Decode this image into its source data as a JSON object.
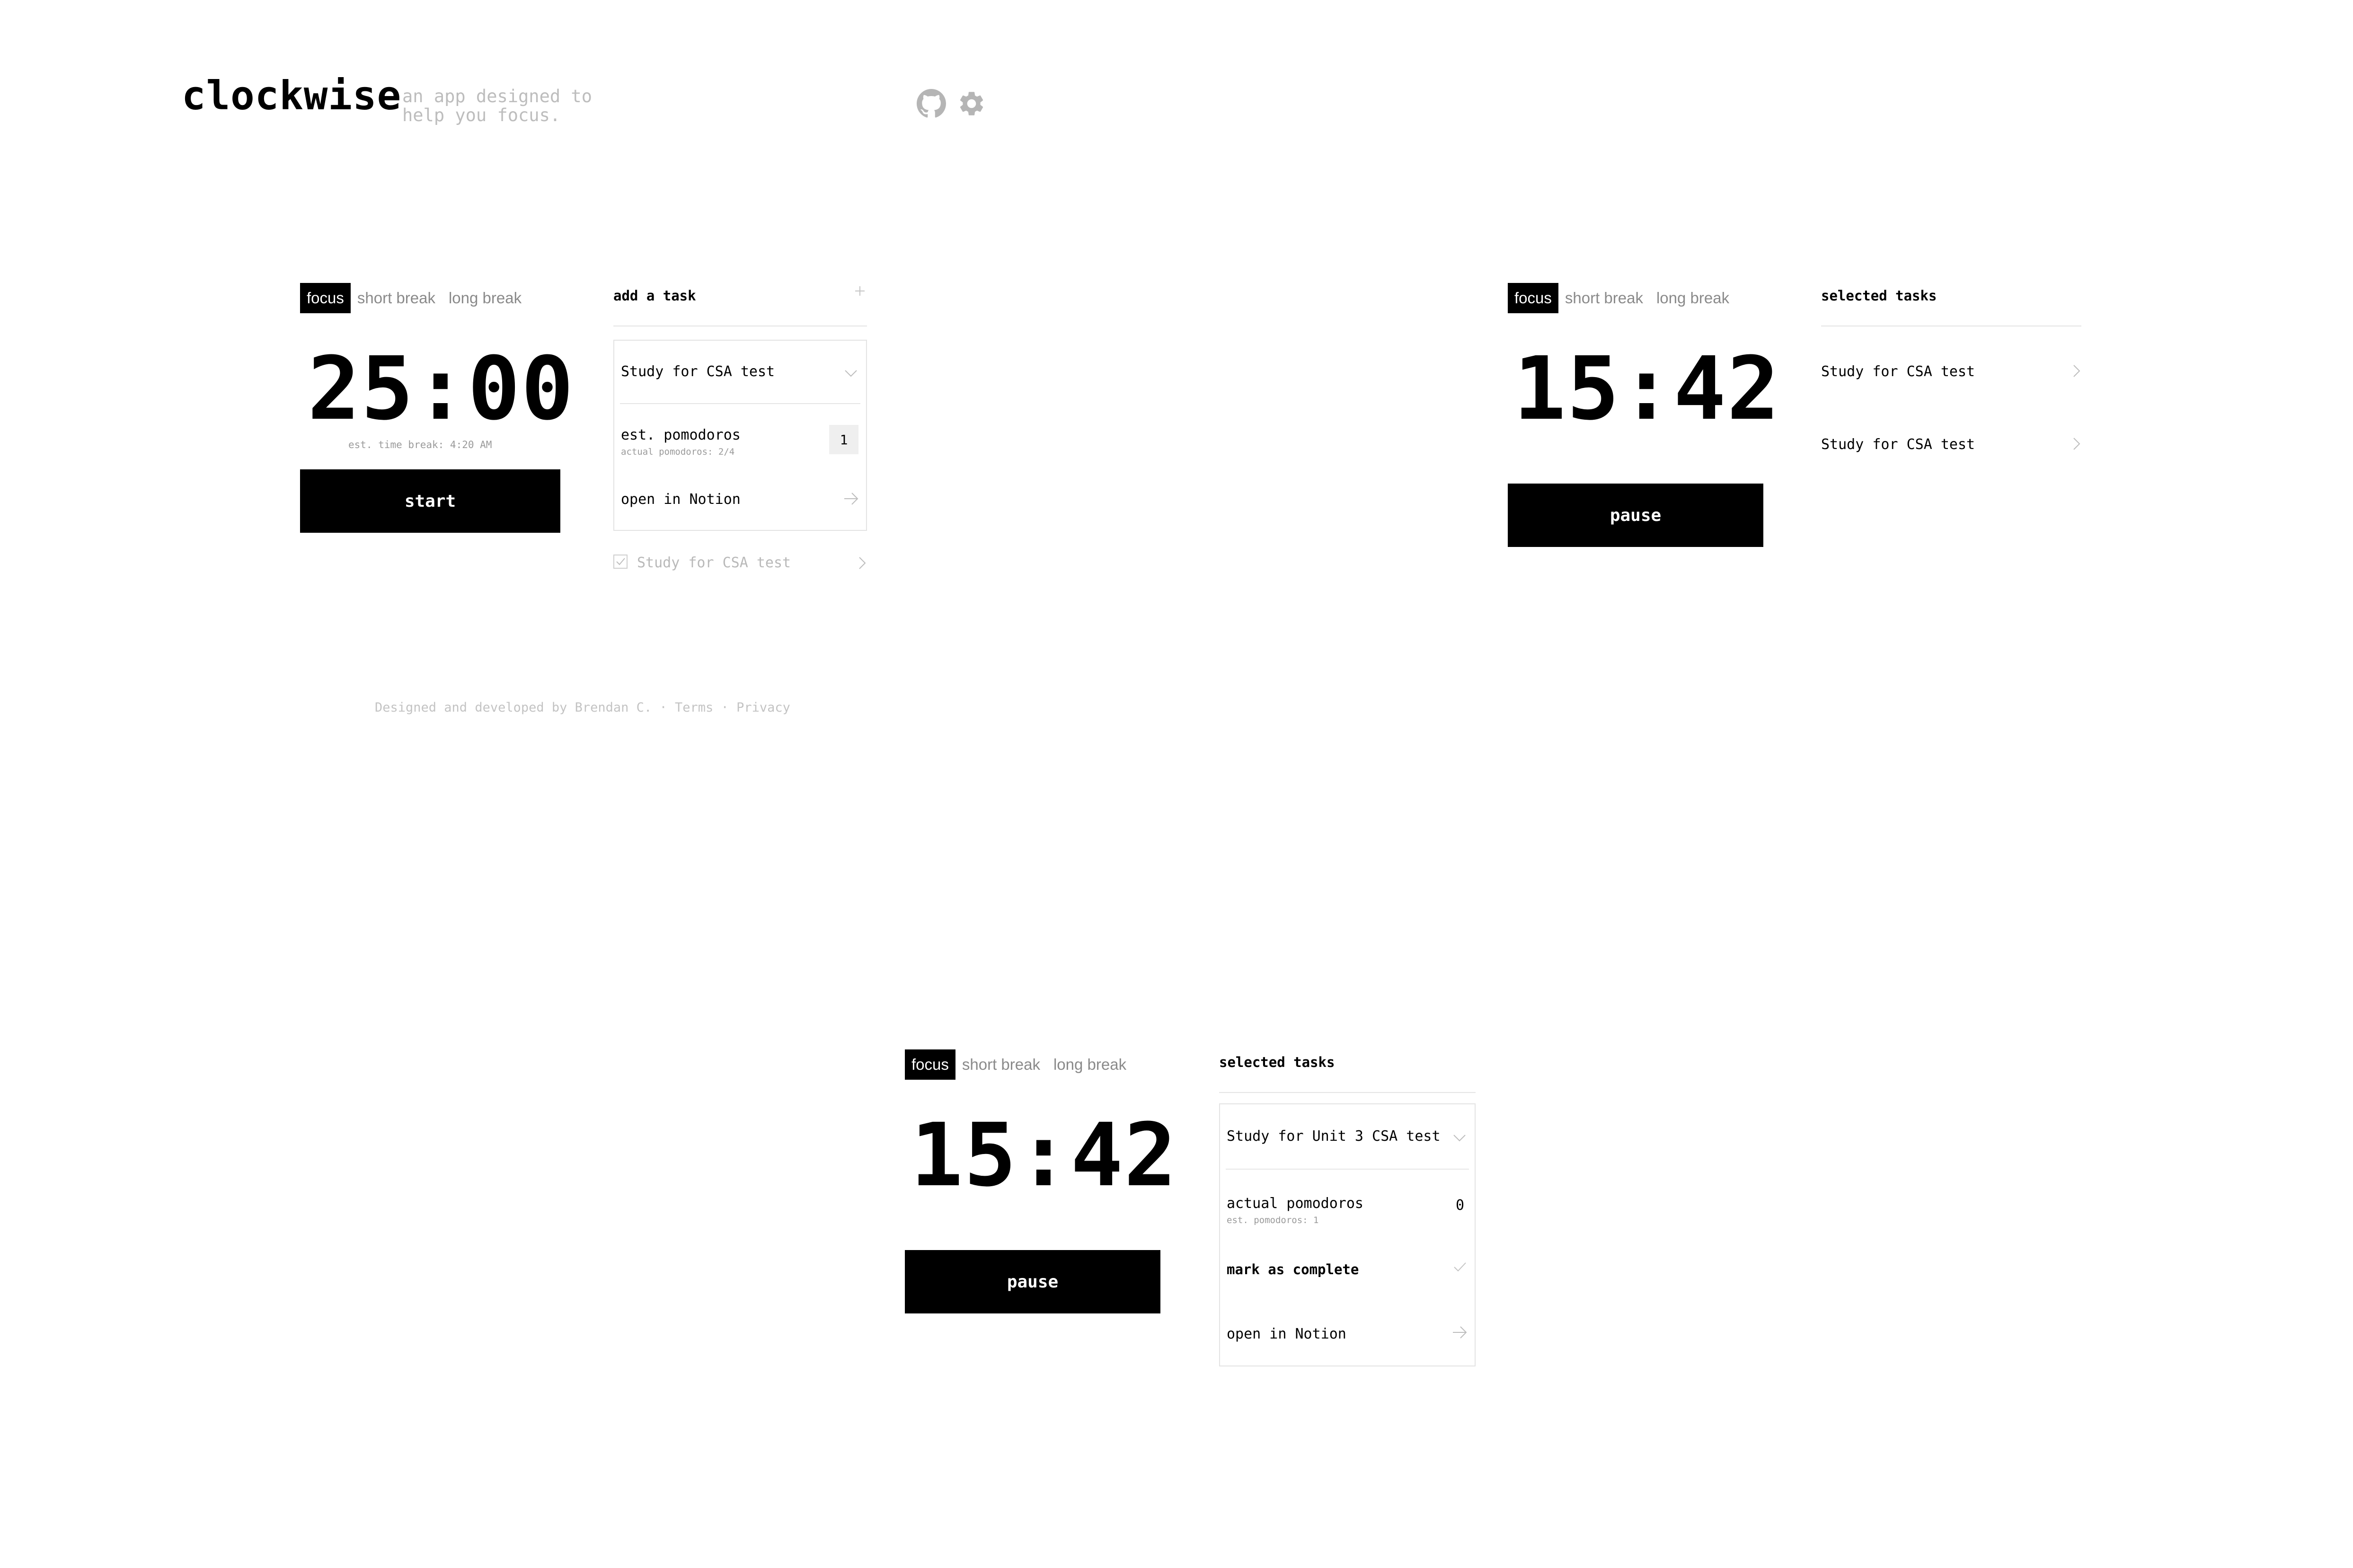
{
  "header": {
    "brand": "clockwise",
    "tagline": "an app designed to help you focus.",
    "icons": [
      "github-icon",
      "gear-icon"
    ]
  },
  "modes": {
    "focus": "focus",
    "short_break": "short break",
    "long_break": "long break"
  },
  "screen_a": {
    "timer": "25:00",
    "est_break": "est. time break: 4:20 AM",
    "start_label": "start",
    "panel_title": "add a task",
    "task": {
      "title": "Study for CSA test",
      "est_label": "est. pomodoros",
      "actual_sub": "actual pomodoros: 2/4",
      "est_value": "1",
      "open_label": "open in Notion"
    },
    "completed_task": "Study for CSA test"
  },
  "footer": {
    "credit": "Designed and developed by Brendan C.",
    "sep": "·",
    "terms": "Terms",
    "privacy": "Privacy"
  },
  "screen_b": {
    "timer": "15:42",
    "pause_label": "pause",
    "panel_title": "selected tasks",
    "tasks": [
      "Study for CSA test",
      "Study for CSA test"
    ]
  },
  "screen_c": {
    "timer": "15:42",
    "pause_label": "pause",
    "panel_title": "selected tasks",
    "task": {
      "title": "Study for Unit 3 CSA test",
      "actual_label": "actual pomodoros",
      "est_sub": "est. pomodoros: 1",
      "actual_value": "0",
      "complete_label": "mark as complete",
      "open_label": "open in Notion"
    }
  }
}
